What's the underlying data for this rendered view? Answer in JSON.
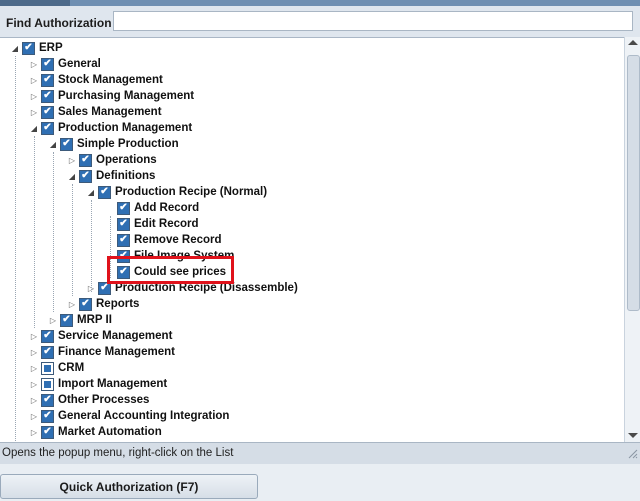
{
  "find": {
    "label": "Find Authorization",
    "value": ""
  },
  "tree": [
    {
      "id": "erp",
      "label": "ERP",
      "level": 0,
      "expander": "open",
      "check": "checked"
    },
    {
      "id": "general",
      "label": "General",
      "level": 1,
      "expander": "closed",
      "check": "checked"
    },
    {
      "id": "stock",
      "label": "Stock Management",
      "level": 1,
      "expander": "closed",
      "check": "checked"
    },
    {
      "id": "purch",
      "label": "Purchasing Management",
      "level": 1,
      "expander": "closed",
      "check": "checked"
    },
    {
      "id": "sales",
      "label": "Sales Management",
      "level": 1,
      "expander": "closed",
      "check": "checked"
    },
    {
      "id": "prod",
      "label": "Production Management",
      "level": 1,
      "expander": "open",
      "check": "checked"
    },
    {
      "id": "simple",
      "label": "Simple Production",
      "level": 2,
      "expander": "open",
      "check": "checked"
    },
    {
      "id": "ops",
      "label": "Operations",
      "level": 3,
      "expander": "closed",
      "check": "checked"
    },
    {
      "id": "defs",
      "label": "Definitions",
      "level": 3,
      "expander": "open",
      "check": "checked"
    },
    {
      "id": "prn",
      "label": "Production Recipe (Normal)",
      "level": 4,
      "expander": "open",
      "check": "checked"
    },
    {
      "id": "add",
      "label": "Add Record",
      "level": 5,
      "expander": "none",
      "check": "checked"
    },
    {
      "id": "edit",
      "label": "Edit Record",
      "level": 5,
      "expander": "none",
      "check": "checked"
    },
    {
      "id": "remove",
      "label": "Remove Record",
      "level": 5,
      "expander": "none",
      "check": "checked"
    },
    {
      "id": "file",
      "label": "File Image System",
      "level": 5,
      "expander": "none",
      "check": "checked"
    },
    {
      "id": "prices",
      "label": "Could see prices",
      "level": 5,
      "expander": "none",
      "check": "checked"
    },
    {
      "id": "prd",
      "label": "Production Recipe (Disassemble)",
      "level": 4,
      "expander": "closed",
      "check": "checked"
    },
    {
      "id": "reports",
      "label": "Reports",
      "level": 3,
      "expander": "closed",
      "check": "checked"
    },
    {
      "id": "mrp",
      "label": "MRP II",
      "level": 2,
      "expander": "closed",
      "check": "checked"
    },
    {
      "id": "service",
      "label": "Service Management",
      "level": 1,
      "expander": "closed",
      "check": "checked"
    },
    {
      "id": "finance",
      "label": "Finance Management",
      "level": 1,
      "expander": "closed",
      "check": "checked"
    },
    {
      "id": "crm",
      "label": "CRM",
      "level": 1,
      "expander": "closed",
      "check": "partial"
    },
    {
      "id": "import",
      "label": "Import Management",
      "level": 1,
      "expander": "closed",
      "check": "partial"
    },
    {
      "id": "other",
      "label": "Other Processes",
      "level": 1,
      "expander": "closed",
      "check": "checked"
    },
    {
      "id": "gai",
      "label": "General Accounting Integration",
      "level": 1,
      "expander": "closed",
      "check": "checked"
    },
    {
      "id": "market",
      "label": "Market Automation",
      "level": 1,
      "expander": "closed",
      "check": "checked"
    }
  ],
  "status": {
    "text": "Opens the popup menu, right-click on the List"
  },
  "buttons": {
    "quick_auth": "Quick Authorization (F7)"
  },
  "colors": {
    "checkbox": "#2f6fb3",
    "highlight": "#e0121b"
  }
}
